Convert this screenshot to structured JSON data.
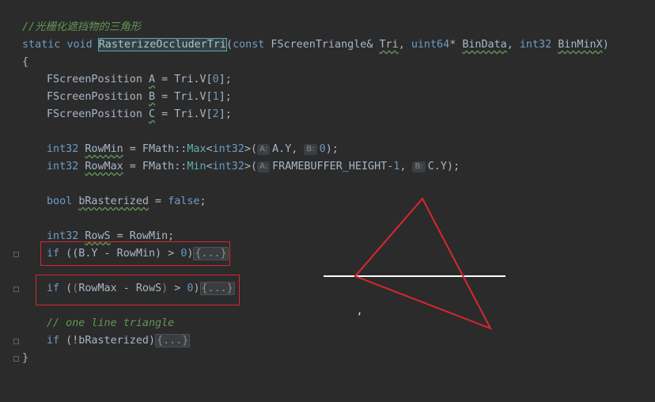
{
  "code": {
    "comment_header": "//光栅化遮挡物的三角形",
    "sig_static": "static",
    "sig_void": "void",
    "sig_fn": "RasterizeOccluderTri",
    "sig_rest_1": "(",
    "sig_const": "const",
    "sig_type1": " FScreenTriangle& ",
    "sig_tri": "Tri",
    "sig_comma1": ", ",
    "sig_uint64": "uint64",
    "sig_star": "* ",
    "sig_bindata": "BinData",
    "sig_comma2": ", ",
    "sig_int32": "int32",
    "sig_sp": " ",
    "sig_binminx": "BinMinX",
    "sig_close": ")",
    "brace_open": "{",
    "brace_close": "}",
    "pos_a_type": "FScreenPosition ",
    "pos_a_var": "A",
    "pos_a_rest": " = Tri.V[",
    "pos_a_idx": "0",
    "pos_a_end": "];",
    "pos_b_type": "FScreenPosition ",
    "pos_b_var": "B",
    "pos_b_rest": " = Tri.V[",
    "pos_b_idx": "1",
    "pos_b_end": "];",
    "pos_c_type": "FScreenPosition ",
    "pos_c_var": "C",
    "pos_c_rest": " = Tri.V[",
    "pos_c_idx": "2",
    "pos_c_end": "];",
    "rowmin_int": "int32",
    "rowmin_var": "RowMin",
    "rowmin_eq": " = FMath::",
    "rowmin_fn": "Max",
    "rowmin_tmpl_open": "<",
    "rowmin_tmpl_kw": "int32",
    "rowmin_tmpl_close": ">(",
    "rowmin_hint_a": "A:",
    "rowmin_arg_a": "A.Y, ",
    "rowmin_hint_b": "B:",
    "rowmin_arg_b": "0",
    "rowmin_end": ");",
    "rowmax_int": "int32",
    "rowmax_var": "RowMax",
    "rowmax_eq": " = FMath::",
    "rowmax_fn": "Min",
    "rowmax_tmpl_open": "<",
    "rowmax_tmpl_kw": "int32",
    "rowmax_tmpl_close": ">(",
    "rowmax_hint_a": "A:",
    "rowmax_arg_a": "FRAMEBUFFER_HEIGHT-",
    "rowmax_arg_a_num": "1",
    "rowmax_arg_a_comma": ", ",
    "rowmax_hint_b": "B:",
    "rowmax_arg_b": "C.Y",
    "rowmax_end": ");",
    "bool_kw": "bool",
    "bool_var": "bRasterized",
    "bool_eq": " = ",
    "bool_val": "false",
    "bool_end": ";",
    "rows_int": "int32",
    "rows_var": "RowS",
    "rows_rest": " = RowMin;",
    "if1_kw": "if",
    "if1_rest": " ((B.Y - RowMin) > ",
    "if1_num": "0",
    "if1_close": ")",
    "if1_fold": "{...}",
    "if2_kw": "if",
    "if2_p1": " (",
    "if2_p2": "(",
    "if2_mid": "RowMax - RowS",
    "if2_p3": ")",
    "if2_gt": " > ",
    "if2_num": "0",
    "if2_close": ")",
    "if2_fold": "{...}",
    "comment_one_line": "// one line triangle",
    "if3_kw": "if",
    "if3_rest": " (!bRasterized)",
    "if3_fold": "{...}"
  },
  "overlay": {
    "red_color": "#d8272e",
    "line_color": "#ffffff",
    "stray_mark": ","
  }
}
